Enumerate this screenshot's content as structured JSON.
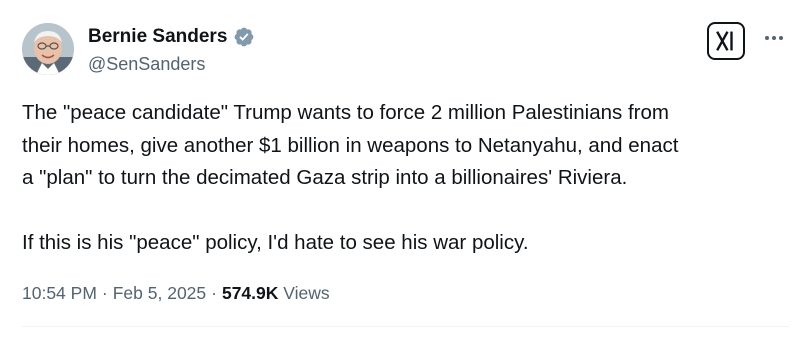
{
  "author": {
    "display_name": "Bernie Sanders",
    "handle": "@SenSanders",
    "verified": true,
    "verified_icon": "verified-badge-icon",
    "avatar_icon": "profile-photo"
  },
  "header_actions": {
    "logo_icon": "x-logo-icon",
    "more_icon": "more-options-icon"
  },
  "tweet": {
    "lines": [
      "The \"peace candidate\" Trump wants to force 2 million Palestinians from",
      "their homes, give another $1 billion in weapons to Netanyahu, and enact",
      "a \"plan\" to turn the decimated Gaza strip into a billionaires' Riviera.",
      "",
      "If this is his \"peace\" policy, I'd hate to see his war policy."
    ]
  },
  "meta": {
    "time": "10:54 PM",
    "separator": "·",
    "date": "Feb 5, 2025",
    "views_count": "574.9K",
    "views_label": "Views"
  },
  "colors": {
    "text_primary": "#0f1419",
    "text_secondary": "#536471",
    "divider": "#eff3f4",
    "verified_badge": "#829aab"
  }
}
